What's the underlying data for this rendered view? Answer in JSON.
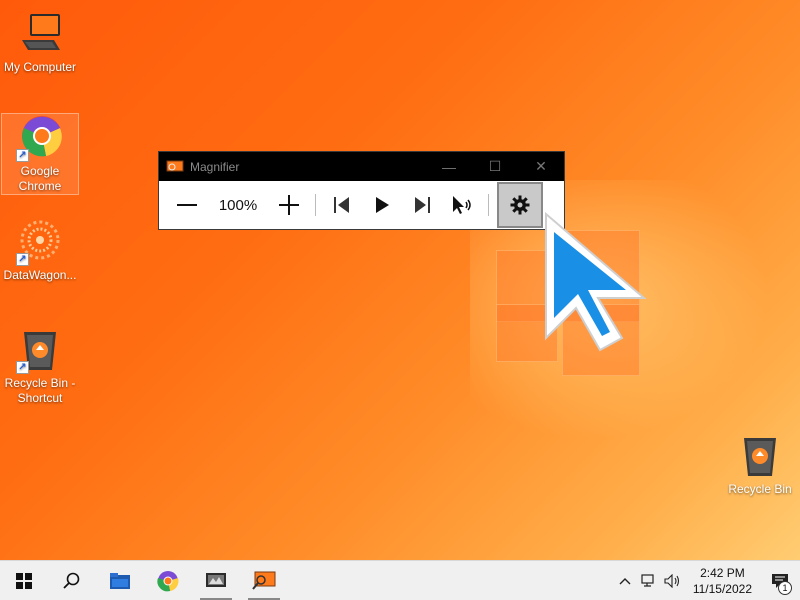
{
  "desktop": {
    "icons": [
      {
        "label": "My Computer",
        "icon": "computer-icon"
      },
      {
        "label": "Google Chrome",
        "icon": "chrome-icon",
        "shortcut": true
      },
      {
        "label": "DataWagon...",
        "icon": "datawagon-icon",
        "shortcut": true
      },
      {
        "label": "Recycle Bin - Shortcut",
        "icon": "recycle-bin-icon",
        "shortcut": true
      },
      {
        "label": "Recycle Bin",
        "icon": "recycle-bin-icon"
      }
    ]
  },
  "magnifier": {
    "title": "Magnifier",
    "zoom": "100%",
    "controls": [
      "zoom-out-icon",
      "zoom-in-icon",
      "previous-paragraph-icon",
      "play-icon",
      "next-paragraph-icon",
      "read-from-here-icon",
      "settings-icon"
    ],
    "window_buttons": {
      "minimize": "—",
      "maximize": "☐",
      "close": "✕"
    }
  },
  "taskbar": {
    "time": "2:42 PM",
    "date": "11/15/2022",
    "notifications": "1",
    "items": [
      "start-icon",
      "search-icon",
      "file-explorer-icon",
      "chrome-icon",
      "datawagon-icon",
      "magnifier-icon"
    ]
  },
  "colors": {
    "accent": "#1a8fe6",
    "wallpaper": "#ff6d12"
  }
}
